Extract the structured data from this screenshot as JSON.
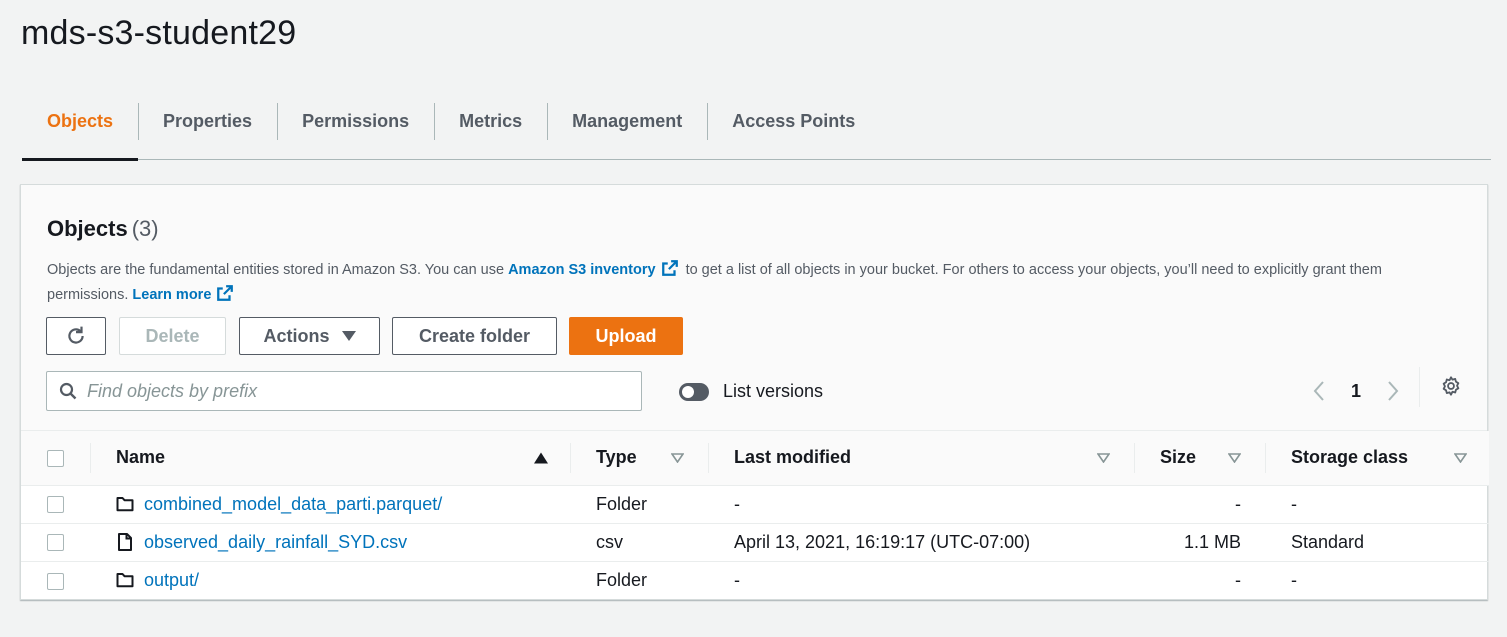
{
  "bucket": {
    "title": "mds-s3-student29"
  },
  "tabs": [
    {
      "label": "Objects",
      "active": true
    },
    {
      "label": "Properties",
      "active": false
    },
    {
      "label": "Permissions",
      "active": false
    },
    {
      "label": "Metrics",
      "active": false
    },
    {
      "label": "Management",
      "active": false
    },
    {
      "label": "Access Points",
      "active": false
    }
  ],
  "objects_panel": {
    "heading": "Objects",
    "count": "(3)",
    "description_part1": "Objects are the fundamental entities stored in Amazon S3. You can use",
    "inventory_link": "Amazon S3 inventory",
    "description_part2": "to get a list of all objects in your bucket. For others to access your objects, you’ll need to explicitly grant them permissions.",
    "learn_more_link": "Learn more"
  },
  "toolbar": {
    "refresh_icon": "refresh-icon",
    "delete_label": "Delete",
    "actions_label": "Actions",
    "create_folder_label": "Create folder",
    "upload_label": "Upload"
  },
  "search": {
    "placeholder": "Find objects by prefix"
  },
  "list_versions": {
    "label": "List versions",
    "enabled": false
  },
  "pagination": {
    "current_page": "1"
  },
  "table": {
    "columns": {
      "name": "Name",
      "type": "Type",
      "last_modified": "Last modified",
      "size": "Size",
      "storage_class": "Storage class"
    },
    "rows": [
      {
        "icon": "folder-icon",
        "name": "combined_model_data_parti.parquet/",
        "type": "Folder",
        "last_modified": "-",
        "size": "-",
        "storage_class": "-"
      },
      {
        "icon": "file-icon",
        "name": "observed_daily_rainfall_SYD.csv",
        "type": "csv",
        "last_modified": "April 13, 2021, 16:19:17 (UTC-07:00)",
        "size": "1.1 MB",
        "storage_class": "Standard"
      },
      {
        "icon": "folder-icon",
        "name": "output/",
        "type": "Folder",
        "last_modified": "-",
        "size": "-",
        "storage_class": "-"
      }
    ]
  },
  "colors": {
    "accent": "#ec7211",
    "link": "#0073bb",
    "text": "#16191f",
    "background": "#f2f3f3"
  }
}
